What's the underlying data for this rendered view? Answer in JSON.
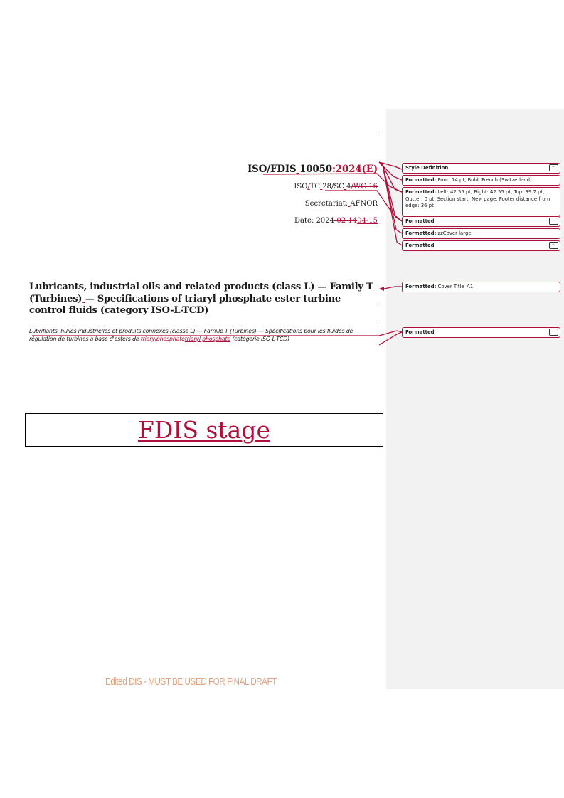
{
  "header": {
    "doc_ref": {
      "base": "ISO/FDIS",
      "ins_space": " ",
      "number": "10050",
      "deleted": ":2024(E)"
    },
    "tc_ref": {
      "pre": "ISO",
      "ins1": "/",
      "mid1": "TC",
      "ins2": " ",
      "mid2": "28/SC",
      "ins3": " ",
      "mid3": "4",
      "deleted": "/WG 16"
    },
    "secretariat": {
      "label": "Secretariat:",
      "ins": " ",
      "value": "AFNOR"
    },
    "date": {
      "label": "Date: 2024",
      "deleted": "-02-14",
      "inserted": "04-15"
    }
  },
  "title_en": {
    "part1": "Lubricants, industrial oils and related products (class L) — Family T (Turbines)",
    "ins": " ",
    "part2": "— Specifications of triaryl phosphate ester turbine control fluids (category ISO-L-TCD)"
  },
  "title_fr": {
    "part1": "Lubrifiants, huiles industrielles et produits connexes (classe L) — Famille T (Turbines)",
    "ins1": " ",
    "part2": "— Spécifications pour les fluides de régulation de turbines à base d'esters de ",
    "deleted": "triarylphosphate",
    "inserted": "triaryl phosphate",
    "part3": " (catégorie ISO-L-TCD)"
  },
  "stage_label": "FDIS stage",
  "footer_note": "Edited DIS - MUST BE USED FOR FINAL DRAFT",
  "balloons": [
    {
      "label": "Style Definition",
      "text": "",
      "has_more": true
    },
    {
      "label": "Formatted:",
      "text": " Font: 14 pt, Bold, French (Switzerland)",
      "has_more": false
    },
    {
      "label": "Formatted:",
      "text": " Left:  42.55 pt, Right:  42.55 pt, Top:  39.7 pt, Gutter:  0 pt, Section start: New page, Footer distance from edge:  36 pt",
      "has_more": false
    },
    {
      "label": "Formatted",
      "text": "",
      "has_more": true
    },
    {
      "label": "Formatted:",
      "text": " zzCover large",
      "has_more": false
    },
    {
      "label": "Formatted",
      "text": "",
      "has_more": true
    },
    {
      "label": "Formatted:",
      "text": " Cover Title_A1",
      "has_more": false
    },
    {
      "label": "Formatted",
      "text": "",
      "has_more": true
    }
  ],
  "more_button_label": "...",
  "colors": {
    "revision": "#b0113a",
    "margin_bg": "#f2f2f2",
    "footer_note": "#e2a27d"
  }
}
